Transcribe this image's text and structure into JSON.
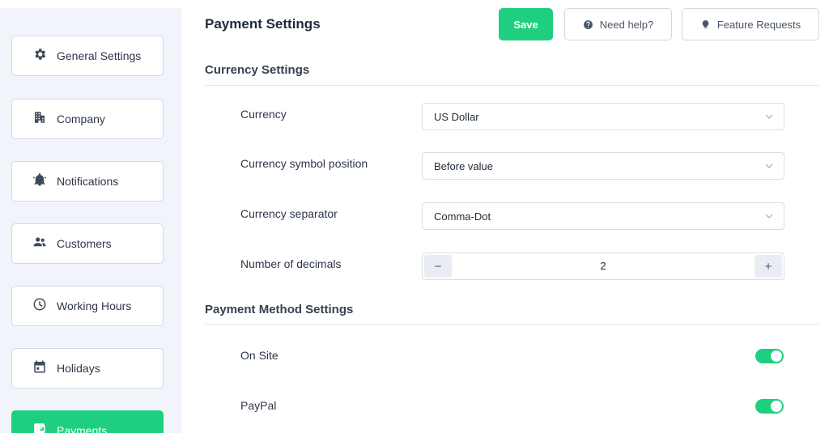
{
  "sidebar": {
    "items": [
      {
        "label": "General Settings",
        "icon": "gear-icon"
      },
      {
        "label": "Company",
        "icon": "building-icon"
      },
      {
        "label": "Notifications",
        "icon": "bell-icon"
      },
      {
        "label": "Customers",
        "icon": "users-icon"
      },
      {
        "label": "Working Hours",
        "icon": "clock-icon"
      },
      {
        "label": "Holidays",
        "icon": "calendar-icon"
      },
      {
        "label": "Payments",
        "icon": "wallet-icon",
        "active": true
      }
    ]
  },
  "header": {
    "title": "Payment Settings",
    "save_label": "Save",
    "help_label": "Need help?",
    "feature_label": "Feature Requests"
  },
  "currency_settings": {
    "title": "Currency Settings",
    "currency": {
      "label": "Currency",
      "value": "US Dollar"
    },
    "symbol_position": {
      "label": "Currency symbol position",
      "value": "Before value"
    },
    "separator": {
      "label": "Currency separator",
      "value": "Comma-Dot"
    },
    "decimals": {
      "label": "Number of decimals",
      "value": "2",
      "minus": "−",
      "plus": "+"
    }
  },
  "payment_methods": {
    "title": "Payment Method Settings",
    "on_site": {
      "label": "On Site",
      "enabled": true
    },
    "paypal": {
      "label": "PayPal",
      "enabled": true
    }
  },
  "colors": {
    "accent": "#1ecf7f",
    "sidebar_bg": "#f1f5fb",
    "border": "#cfd8e3"
  }
}
